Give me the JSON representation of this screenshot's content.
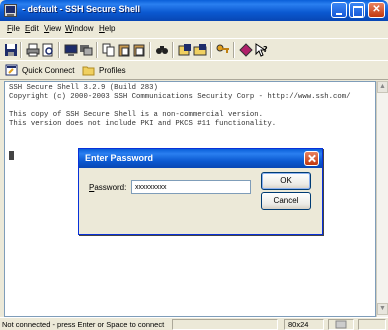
{
  "window": {
    "title": "- default - SSH Secure Shell"
  },
  "menu": [
    {
      "label": "File",
      "accel": "F",
      "rest": "ile"
    },
    {
      "label": "Edit",
      "accel": "E",
      "rest": "dit"
    },
    {
      "label": "View",
      "accel": "V",
      "rest": "iew"
    },
    {
      "label": "Window",
      "accel": "W",
      "rest": "indow"
    },
    {
      "label": "Help",
      "accel": "H",
      "rest": "elp"
    }
  ],
  "toolbar_icons": [
    "save-icon",
    "print-icon",
    "print-preview-icon",
    "new-terminal-icon",
    "new-file-transfer-icon",
    "copy-icon",
    "paste-icon",
    "paste-special-icon",
    "find-icon",
    "settings-icon",
    "settings-folder-icon",
    "key-icon",
    "certificate-icon",
    "help-icon"
  ],
  "profile_bar": {
    "quick_connect": "Quick Connect",
    "profiles": "Profiles"
  },
  "terminal": {
    "lines": [
      "SSH Secure Shell 3.2.9 (Build 283)",
      "Copyright (c) 2000-2003 SSH Communications Security Corp - http://www.ssh.com/",
      "",
      "This copy of SSH Secure Shell is a non-commercial version.",
      "This version does not include PKI and PKCS #11 functionality."
    ]
  },
  "status": {
    "message": "Not connected - press Enter or Space to connect",
    "size": "80x24"
  },
  "dialog": {
    "title": "Enter Password",
    "password_label": "Password:",
    "password_accel": "P",
    "password_rest": "assword:",
    "password_value": "xxxxxxxxx",
    "ok_label": "OK",
    "cancel_label": "Cancel"
  },
  "colors": {
    "titlebar": "#0a58d0",
    "window_bg": "#ece9d8",
    "close_button": "#c2380e"
  }
}
